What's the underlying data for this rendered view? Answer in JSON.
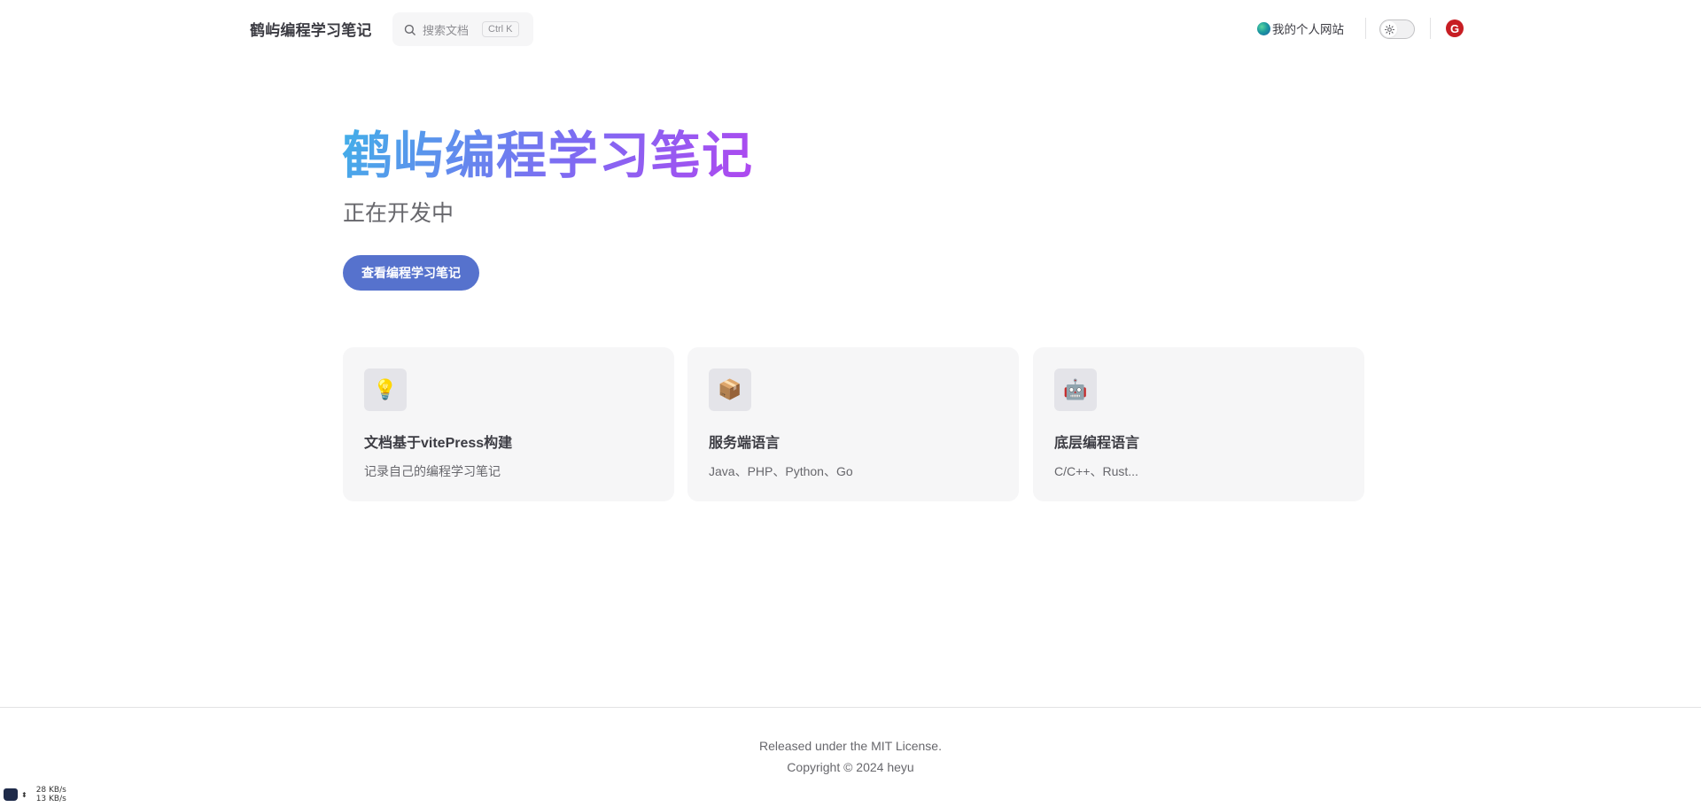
{
  "nav": {
    "title": "鹤屿编程学习笔记",
    "search_placeholder": "搜索文档",
    "search_shortcut": "Ctrl K",
    "site_link": "我的个人网站",
    "gitee_letter": "G"
  },
  "hero": {
    "name": "鹤屿编程学习笔记",
    "text": "正在开发中",
    "action": "查看编程学习笔记"
  },
  "features": [
    {
      "icon": "💡",
      "icon_name": "lightbulb-icon",
      "title": "文档基于vitePress构建",
      "details": "记录自己的编程学习笔记"
    },
    {
      "icon": "📦",
      "icon_name": "package-icon",
      "title": "服务端语言",
      "details": "Java、PHP、Python、Go"
    },
    {
      "icon": "🤖",
      "icon_name": "robot-icon",
      "title": "底层编程语言",
      "details": "C/C++、Rust..."
    }
  ],
  "footer": {
    "message": "Released under the MIT License.",
    "copyright": "Copyright © 2024 heyu"
  },
  "net_widget": {
    "upload": "28 KB/s",
    "download": "13 KB/s"
  },
  "colors": {
    "brand": "#5672cd",
    "gradient_start": "#41b0e8",
    "gradient_end": "#b047f0",
    "gitee_red": "#c71d23"
  }
}
